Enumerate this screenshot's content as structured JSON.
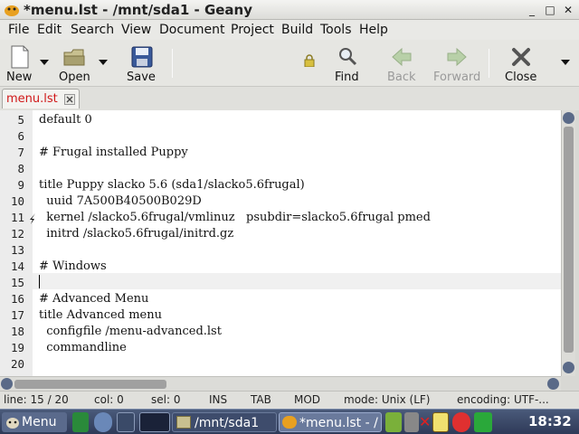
{
  "window": {
    "title": "*menu.lst - /mnt/sda1 - Geany",
    "minimize_glyph": "_",
    "maximize_glyph": "□",
    "close_glyph": "✕",
    "icons": {
      "app": "geany-icon"
    }
  },
  "menubar": [
    "File",
    "Edit",
    "Search",
    "View",
    "Document",
    "Project",
    "Build",
    "Tools",
    "Help"
  ],
  "toolbar": {
    "new": "New",
    "open": "Open",
    "save": "Save",
    "find": "Find",
    "back": "Back",
    "forward": "Forward",
    "close": "Close",
    "search_value": ""
  },
  "tabs": [
    {
      "label": "menu.lst",
      "active": true,
      "modified": true
    }
  ],
  "editor": {
    "lines": [
      {
        "num": "5",
        "text": "default 0"
      },
      {
        "num": "6",
        "text": ""
      },
      {
        "num": "7",
        "text": "# Frugal installed Puppy"
      },
      {
        "num": "8",
        "text": ""
      },
      {
        "num": "9",
        "text": "title Puppy slacko 5.6 (sda1/slacko5.6frugal)"
      },
      {
        "num": "10",
        "text": "  uuid 7A500B40500B029D"
      },
      {
        "num": "11",
        "text": "  kernel /slacko5.6frugal/vmlinuz   psubdir=slacko5.6frugal pmed"
      },
      {
        "num": "12",
        "text": "  initrd /slacko5.6frugal/initrd.gz"
      },
      {
        "num": "13",
        "text": ""
      },
      {
        "num": "14",
        "text": "# Windows"
      },
      {
        "num": "15",
        "text": ""
      },
      {
        "num": "16",
        "text": "# Advanced Menu"
      },
      {
        "num": "17",
        "text": "title Advanced menu"
      },
      {
        "num": "18",
        "text": "  configfile /menu-advanced.lst"
      },
      {
        "num": "19",
        "text": "  commandline"
      },
      {
        "num": "20",
        "text": ""
      }
    ],
    "current_line": "15"
  },
  "statusbar": {
    "line": "line: 15 / 20",
    "col": "col: 0",
    "sel": "sel: 0",
    "ins": "INS",
    "tab": "TAB",
    "mod": "MOD",
    "mode": "mode: Unix (LF)",
    "encoding": "encoding: UTF-..."
  },
  "taskbar": {
    "menu": "Menu",
    "tasks": [
      "/mnt/sda1",
      "*menu.lst - /"
    ],
    "clock": "18:32"
  },
  "colors": {
    "tab_label": "#d01818",
    "accent": "#5a6a88"
  }
}
